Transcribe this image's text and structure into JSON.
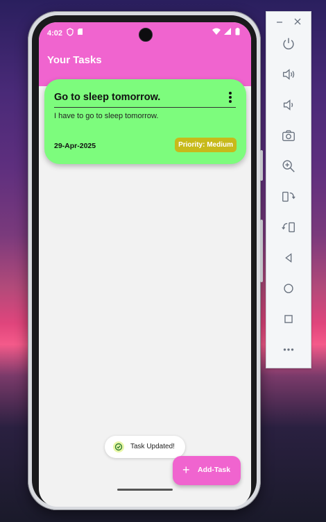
{
  "status": {
    "time": "4:02"
  },
  "appbar": {
    "title": "Your Tasks"
  },
  "task": {
    "title": "Go to sleep tomorrow.",
    "description": "I have to go to sleep tomorrow.",
    "date": "29-Apr-2025",
    "priority": "Priority: Medium",
    "card_color": "#7dfc7d",
    "priority_color": "#c7ba1a"
  },
  "toast": {
    "text": "Task Updated!"
  },
  "fab": {
    "label": "Add-Task",
    "icon": "plus-icon"
  },
  "theme": {
    "accent": "#f064cf",
    "background": "#f2f2f2"
  },
  "emulator_panel": {
    "window_controls": [
      "minimize-icon",
      "close-icon"
    ],
    "buttons": [
      "power-icon",
      "volume-up-icon",
      "volume-down-icon",
      "camera-icon",
      "zoom-icon",
      "rotate-left-icon",
      "rotate-right-icon",
      "back-icon",
      "home-icon",
      "overview-icon",
      "more-icon"
    ]
  }
}
